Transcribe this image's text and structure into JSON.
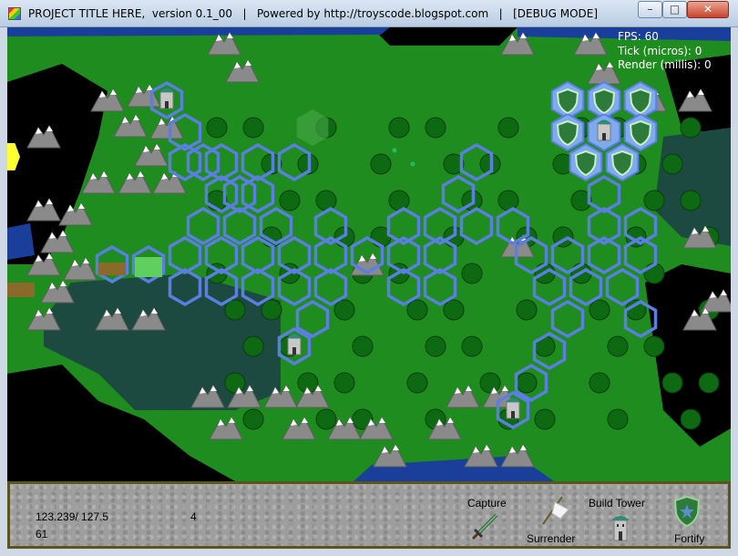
{
  "window": {
    "title": "PROJECT TITLE HERE,  version 0.1_00   |   Powered by http://troyscode.blogspot.com   |   [DEBUG MODE]",
    "minimize_glyph": "–",
    "maximize_glyph": "□",
    "close_glyph": "✕"
  },
  "debug": {
    "fps": "FPS: 60",
    "tick": "Tick (micros): 0",
    "render": "Render (millis): 0"
  },
  "hud": {
    "coords": "123.239/ 127.5",
    "value_a": "61",
    "value_b": "4",
    "actions": {
      "capture": "Capture",
      "surrender": "Surrender",
      "build_tower": "Build Tower",
      "fortify": "Fortify"
    }
  },
  "colors": {
    "grass": "#1e8c1e",
    "grass_alt": "#189018",
    "forest": "#0e6a12",
    "swamp": "#1d4a40",
    "water": "#1a3f9a",
    "void": "#000000",
    "path_hex": "#5b7fe0",
    "territory": "#7faaee",
    "ui_panel": "#9e9e9e",
    "ui_border": "#5a5520"
  },
  "icons": {
    "capture": "sword-icon",
    "surrender": "white-flag-icon",
    "build_tower": "tower-icon",
    "fortify": "shield-icon"
  }
}
